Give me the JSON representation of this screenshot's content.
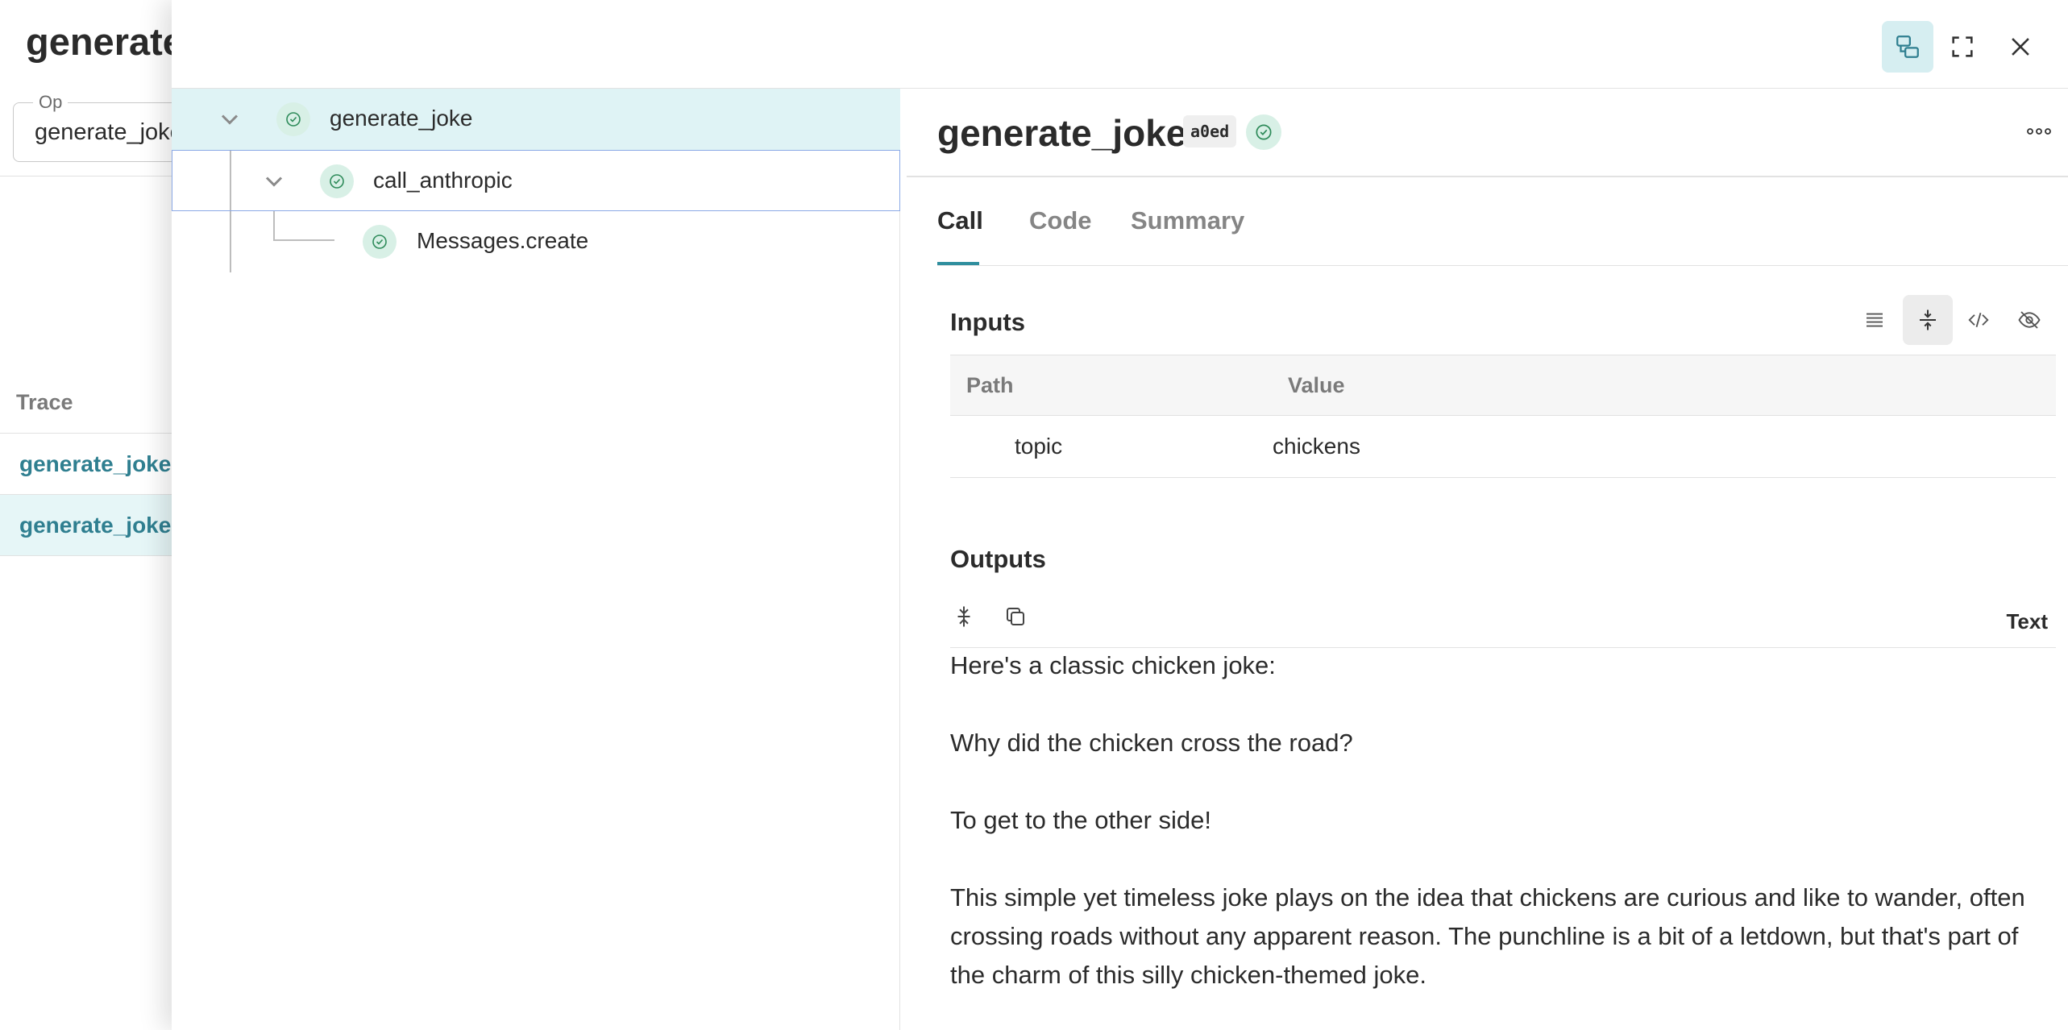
{
  "background_page": {
    "title": "generate",
    "filter": {
      "label": "Op",
      "value": "generate_joke"
    },
    "trace_header": "Trace",
    "rows": [
      "generate_joke",
      "generate_joke"
    ]
  },
  "drawer_header": {
    "buttons": [
      {
        "icon": "split-view-icon",
        "active": true
      },
      {
        "icon": "fullscreen-icon",
        "active": false
      },
      {
        "icon": "close-icon",
        "active": false
      }
    ]
  },
  "tree": {
    "nodes": [
      {
        "label": "generate_joke",
        "status": "success",
        "expanded": true,
        "selected": true
      },
      {
        "label": "call_anthropic",
        "status": "success",
        "expanded": true,
        "focused": true
      },
      {
        "label": "Messages.create",
        "status": "success"
      }
    ]
  },
  "detail": {
    "title": "generate_joke",
    "badge": "a0ed",
    "status": "success",
    "tabs": [
      {
        "label": "Call",
        "active": true
      },
      {
        "label": "Code",
        "active": false
      },
      {
        "label": "Summary",
        "active": false
      }
    ],
    "inputs": {
      "title": "Inputs",
      "columns": [
        "Path",
        "Value"
      ],
      "rows": [
        {
          "path": "topic",
          "value": "chickens"
        }
      ]
    },
    "outputs": {
      "title": "Outputs",
      "format": "Text",
      "lines": [
        "Here's a classic chicken joke:",
        "Why did the chicken cross the road?",
        "To get to the other side!",
        "This simple yet timeless joke plays on the idea that chickens are curious and like to wander, often crossing roads without any apparent reason. The punchline is a bit of a letdown, but that's part of the charm of this silly chicken-themed joke."
      ]
    }
  },
  "colors": {
    "accent": "#2f8e9e",
    "selected_row": "#dff3f5",
    "status_bg": "#d8f0e6",
    "status_fg": "#2e8b5a",
    "link": "#2f7f90"
  }
}
